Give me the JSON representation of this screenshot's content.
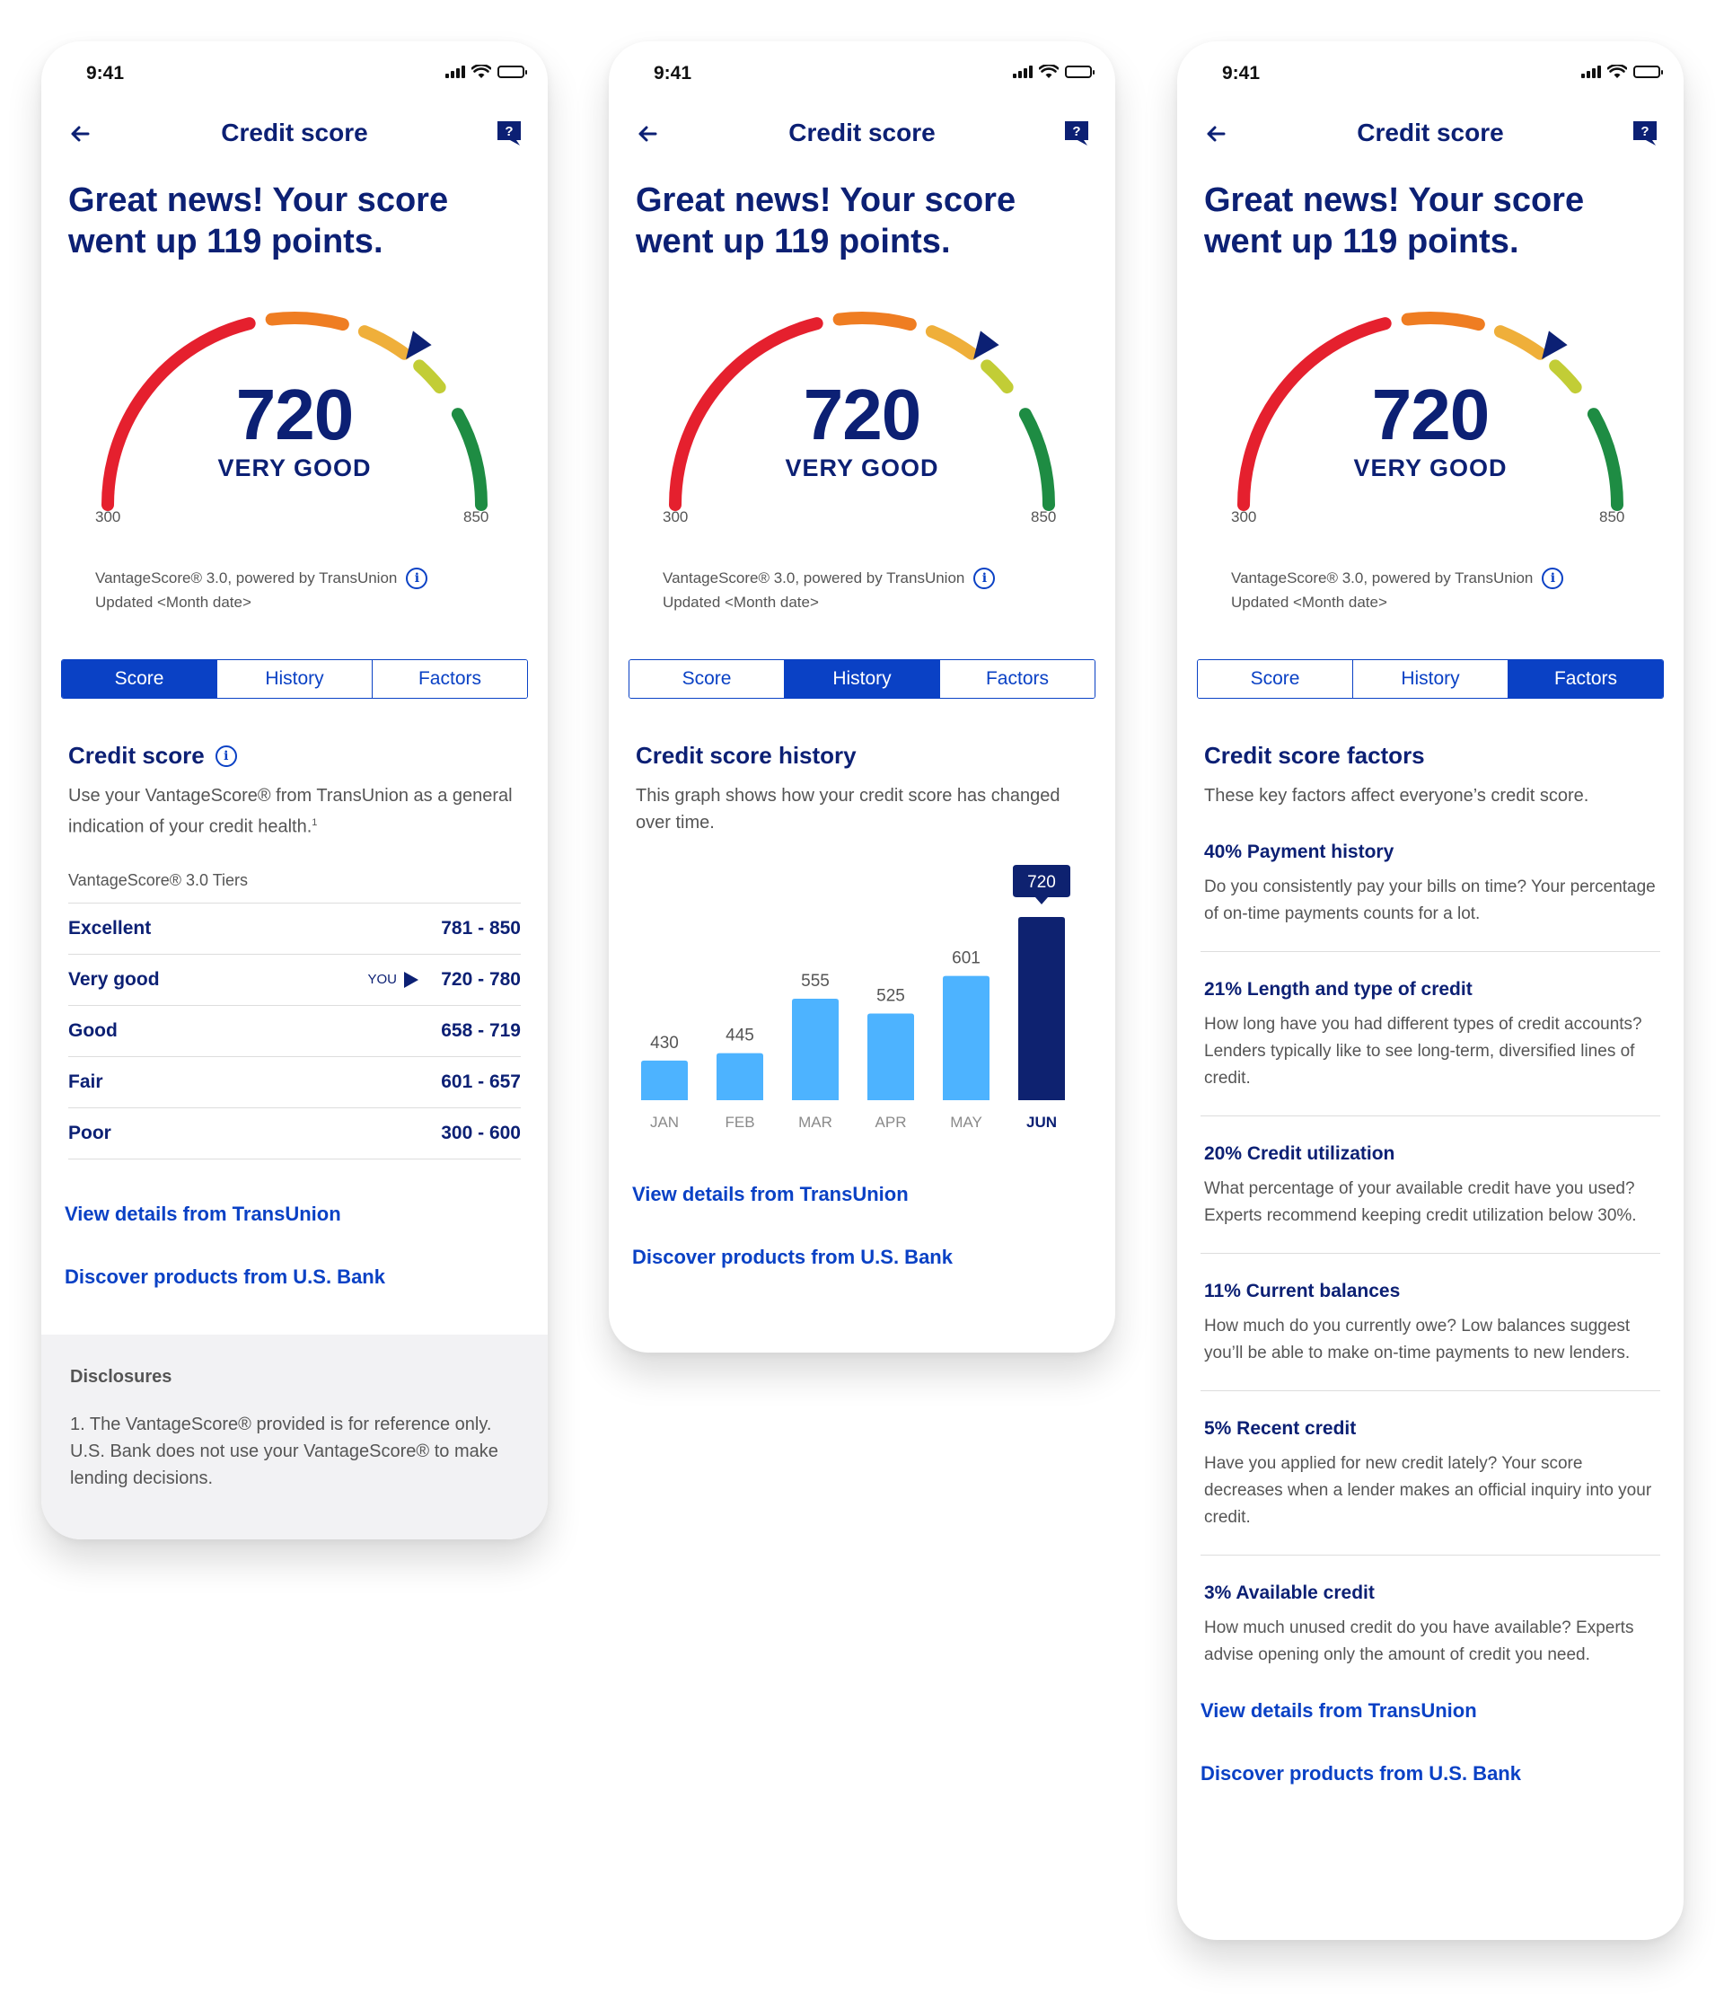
{
  "status_time": "9:41",
  "nav_title": "Credit score",
  "headline_line1": "Great news! Your score",
  "headline_line2": "went up 119 points.",
  "gauge": {
    "score": "720",
    "rating": "VERY GOOD",
    "min": "300",
    "max": "850"
  },
  "source_line1": "VantageScore® 3.0, powered by TransUnion",
  "source_line2": "Updated <Month date>",
  "tabs": [
    "Score",
    "History",
    "Factors"
  ],
  "links": {
    "transunion": "View details from TransUnion",
    "usbank": "Discover products from U.S. Bank"
  },
  "colors": {
    "navy": "#0c2074",
    "blue": "#0a41c5",
    "bar": "#4db3ff",
    "bar_active": "#0e2270"
  },
  "score_screen": {
    "title": "Credit score",
    "desc": "Use your VantageScore® from TransUnion as a general indication of your credit health.",
    "footnote": "1",
    "tiers_caption": "VantageScore® 3.0 Tiers",
    "you_label": "YOU",
    "tiers": [
      {
        "name": "Excellent",
        "range": "781 - 850"
      },
      {
        "name": "Very good",
        "range": "720 - 780"
      },
      {
        "name": "Good",
        "range": "658 - 719"
      },
      {
        "name": "Fair",
        "range": "601 - 657"
      },
      {
        "name": "Poor",
        "range": "300 - 600"
      }
    ],
    "disclosures_title": "Disclosures",
    "disclosures_text": "1. The VantageScore® provided is for reference only. U.S. Bank does not use your VantageScore® to make lending decisions."
  },
  "history_screen": {
    "title": "Credit score history",
    "desc": "This graph shows how your credit score has changed over time."
  },
  "chart_data": {
    "type": "bar",
    "categories": [
      "JAN",
      "FEB",
      "MAR",
      "APR",
      "MAY",
      "JUN"
    ],
    "values": [
      430,
      445,
      555,
      525,
      601,
      720
    ],
    "highlighted": "JUN"
  },
  "factors_screen": {
    "title": "Credit score factors",
    "desc": "These key factors affect everyone’s credit score.",
    "factors": [
      {
        "title": "40% Payment history",
        "desc": "Do you consistently pay your bills on time? Your percentage of on-time payments counts for a lot."
      },
      {
        "title": "21% Length and type of credit",
        "desc": "How long have you had different types of credit accounts? Lenders typically like to see long-term, diversified lines of credit."
      },
      {
        "title": "20% Credit utilization",
        "desc": "What percentage of your available credit have you used? Experts recommend keeping credit utilization below 30%."
      },
      {
        "title": "11% Current balances",
        "desc": "How much do you currently owe? Low balances suggest you’ll be able to make on-time payments to new lenders."
      },
      {
        "title": "5% Recent credit",
        "desc": "Have you applied for new credit lately? Your score decreases when a lender makes an official inquiry into your credit."
      },
      {
        "title": "3% Available credit",
        "desc": "How much unused credit do you have available? Experts advise opening only the amount of credit you need."
      }
    ]
  }
}
